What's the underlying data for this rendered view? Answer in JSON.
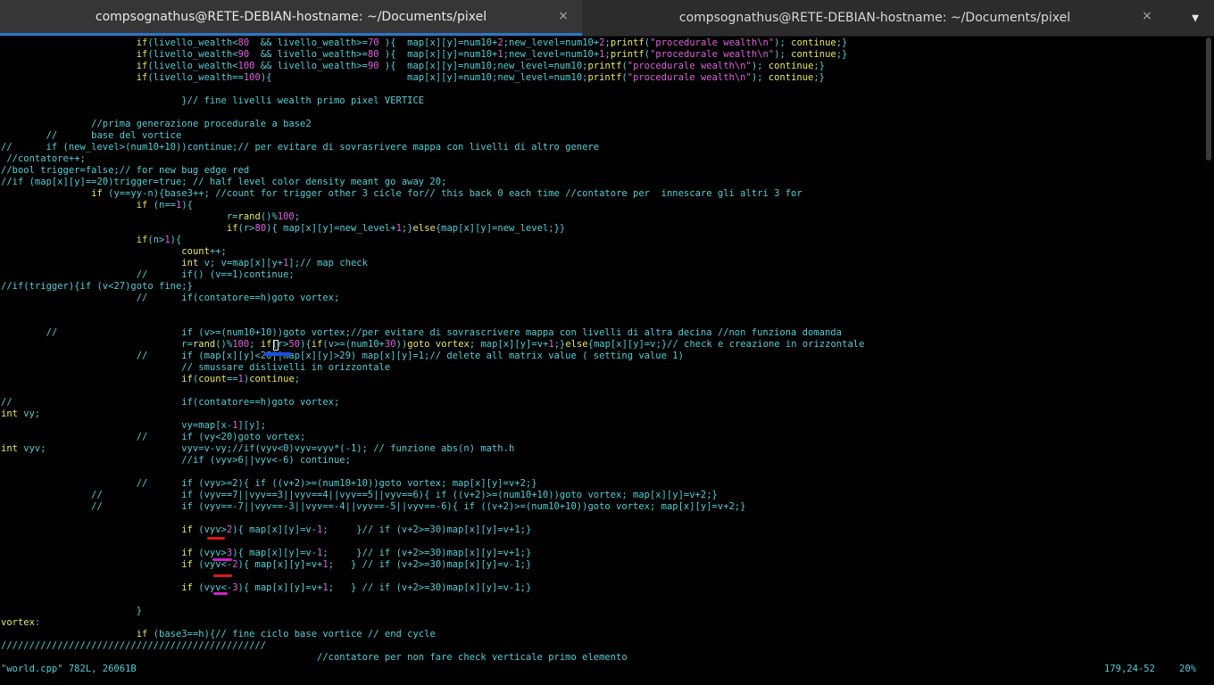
{
  "tabs": [
    {
      "title": "compsognathus@RETE-DEBIAN-hostname: ~/Documents/pixel"
    },
    {
      "title": "compsognathus@RETE-DEBIAN-hostname: ~/Documents/pixel"
    }
  ],
  "icons": {
    "close": "×",
    "menu": "▼"
  },
  "code_lines": [
    "                        if(livello_wealth<80  && livello_wealth>=70 ){  map[x][y]=num10+2;new_level=num10+2;printf(\"procedurale wealth\\n\"); continue;}",
    "                        if(livello_wealth<90  && livello_wealth>=80 ){  map[x][y]=num10+1;new_level=num10+1;printf(\"procedurale wealth\\n\"); continue;}",
    "                        if(livello_wealth<100 && livello_wealth>=90 ){  map[x][y]=num10;new_level=num10;printf(\"procedurale wealth\\n\"); continue;}",
    "                        if(livello_wealth==100){                        map[x][y]=num10;new_level=num10;printf(\"procedurale wealth\\n\"); continue;}",
    "",
    "                                }// fine livelli wealth primo pixel VERTICE",
    "",
    "                //prima generazione procedurale a base2",
    "        //      base del vortice",
    "//      if (new_level>(num10+10))continue;// per evitare di sovrasrivere mappa con livelli di altro genere",
    " //contatore++;",
    "//bool trigger=false;// for new bug edge red",
    "//if (map[x][y]==20)trigger=true; // half level color density meant go away 20;",
    "                if (y==yy-n){base3++; //count for trigger other 3 cicle for// this back 0 each time //contatore per  innescare gli altri 3 for",
    "                        if (n==1){",
    "                                        r=rand()%100;",
    "                                        if(r>80){ map[x][y]=new_level+1;}else{map[x][y]=new_level;}}",
    "                        if(n>1){",
    "                                count++;",
    "                                int v; v=map[x][y+1];// map check",
    "                        //      if() (v==1)continue;",
    "//if(trigger){if (v<27)goto fine;}",
    "                        //      if(contatore==h)goto vortex;",
    "",
    "",
    "        //                      if (v>=(num10+10))goto vortex;//per evitare di sovrascrivere mappa con livelli di altra decina //non funziona domanda",
    "                                r=rand()%100; if(r>50){if(v>=(num10+30))goto vortex; map[x][y]=v+1;}else{map[x][y]=v;}// check e creazione in orizzontale",
    "                        //      if (map[x][y]<20||map[x][y]>29) map[x][y]=1;// delete all matrix value ( setting value 1)",
    "                                // smussare dislivelli in orizzontale",
    "                                if(count==1)continue;",
    "",
    "//                              if(contatore==h)goto vortex;",
    "int vy;",
    "                                vy=map[x-1][y];",
    "                        //      if (vy<20)goto vortex;",
    "int vyv;                        vyv=v-vy;//if(vyv<0)vyv=vyv*(-1); // funzione abs(n) math.h",
    "                                //if (vyv>6||vyv<-6) continue;",
    "",
    "                        //      if (vyv>=2){ if ((v+2)>=(num10+10))goto vortex; map[x][y]=v+2;}",
    "                //              if (vyv==7||vyv==3||vyv==4||vyv==5||vyv==6){ if ((v+2)>=(num10+10))goto vortex; map[x][y]=v+2;}",
    "                //              if (vyv==-7||vyv==-3||vyv==-4||vyv==-5||vyv==-6){ if ((v+2)>=(num10+10))goto vortex; map[x][y]=v+2;}",
    "",
    "                                if (vyv>2){ map[x][y]=v-1;     }// if (v+2>=30)map[x][y]=v+1;}",
    "",
    "                                if (vyv>3){ map[x][y]=v-1;     }// if (v+2>=30)map[x][y]=v+1;}",
    "                                if (vyv<-2){ map[x][y]=v+1;   } // if (v+2>=30)map[x][y]=v-1;}",
    "",
    "                                if (vyv<-3){ map[x][y]=v+1;   } // if (v+2>=30)map[x][y]=v-1;}",
    "",
    "                        }",
    "vortex:",
    "                        if (base3==h){// fine ciclo base vortice // end cycle",
    "///////////////////////////////////////////////",
    "                                                        //contatore per non fare check verticale primo elemento"
  ],
  "status": {
    "file": "\"world.cpp\" 782L, 26061B",
    "position": "179,24-52",
    "percent": "20%"
  },
  "colors": {
    "code": "#4fd0d8",
    "comment": "#4fd0d8",
    "keyword": "#e8e860",
    "number": "#e060e0",
    "string": "#e060e0",
    "tab_active_accent": "#2a76c6",
    "mark_blue": "#1e50e0",
    "mark_red": "#e01818",
    "mark_magenta": "#d020c8"
  }
}
